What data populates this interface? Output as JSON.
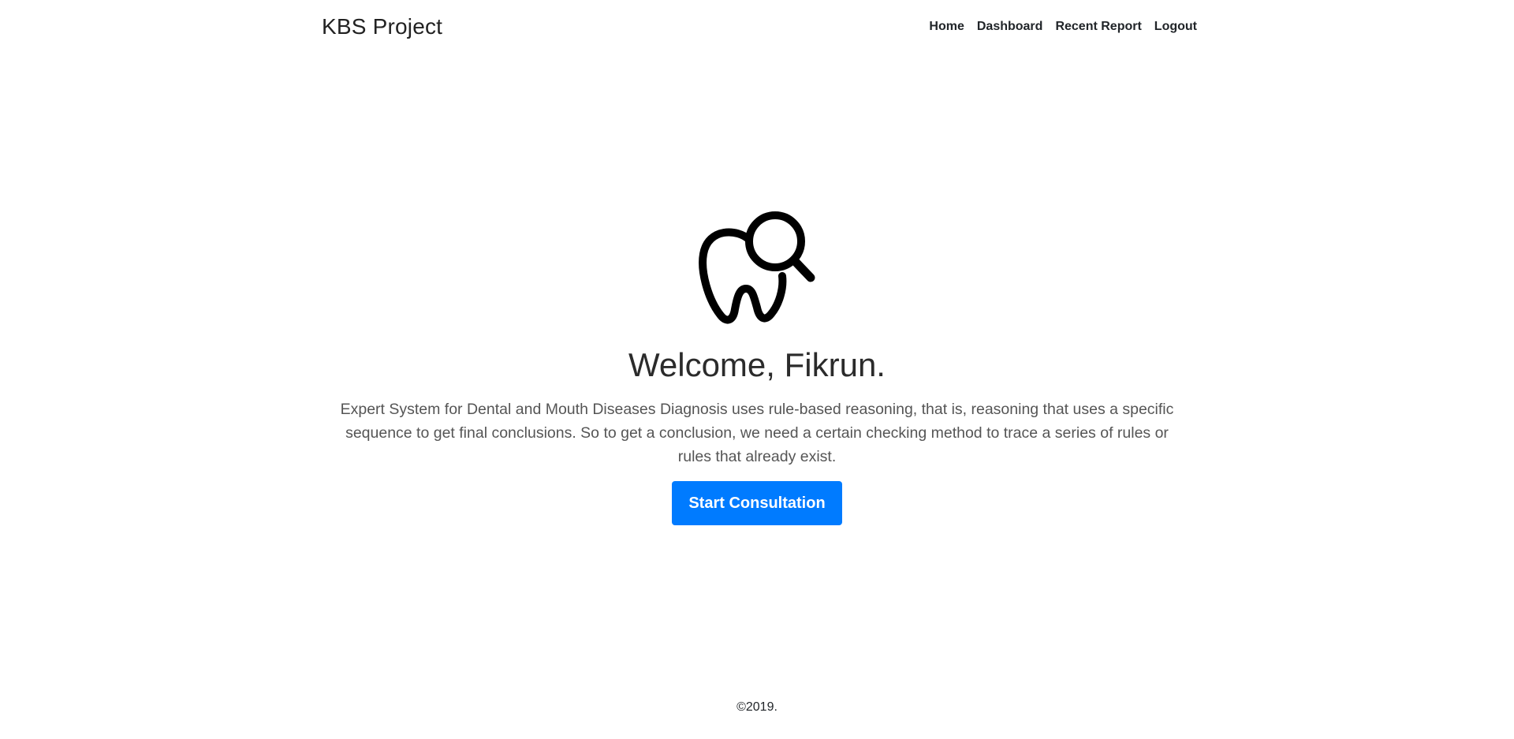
{
  "header": {
    "brand": "KBS Project",
    "nav": [
      {
        "label": "Home"
      },
      {
        "label": "Dashboard"
      },
      {
        "label": "Recent Report"
      },
      {
        "label": "Logout"
      }
    ]
  },
  "hero": {
    "icon": "tooth-search-icon",
    "welcome": "Welcome, Fikrun.",
    "description": "Expert System for Dental and Mouth Diseases Diagnosis uses rule-based reasoning, that is, reasoning that uses a specific sequence to get final conclusions. So to get a conclusion, we need a certain checking method to trace a series of rules or rules that already exist.",
    "cta_label": "Start Consultation"
  },
  "footer": {
    "copyright": "©2019."
  },
  "colors": {
    "primary": "#007bff",
    "text": "#333333",
    "icon": "#000000"
  }
}
